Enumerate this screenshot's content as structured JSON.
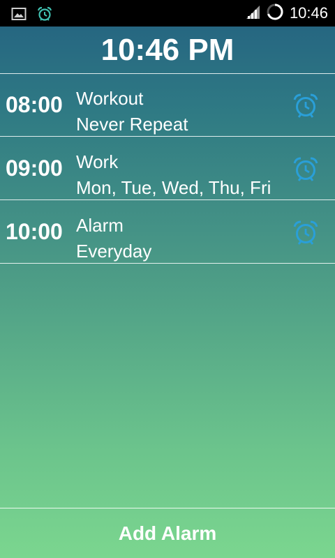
{
  "status_bar": {
    "time": "10:46",
    "left_icons": [
      "image-icon",
      "alarm-clock-icon"
    ],
    "right_icons": [
      "signal-icon",
      "loading-ring-icon"
    ]
  },
  "header": {
    "current_time": "10:46 PM"
  },
  "alarms": [
    {
      "time": "08:00",
      "name": "Workout",
      "repeat": "Never Repeat",
      "icon": "alarm-clock-icon"
    },
    {
      "time": "09:00",
      "name": "Work",
      "repeat": "Mon, Tue, Wed, Thu, Fri",
      "icon": "alarm-clock-icon"
    },
    {
      "time": "10:00",
      "name": "Alarm",
      "repeat": "Everyday",
      "icon": "alarm-clock-icon"
    }
  ],
  "add_button": {
    "label": "Add Alarm"
  },
  "colors": {
    "gradient_top": "#236080",
    "gradient_bottom": "#7bd68f",
    "alarm_icon": "#2a9fd8",
    "status_icon": "#40c0b0",
    "text": "#ffffff"
  }
}
